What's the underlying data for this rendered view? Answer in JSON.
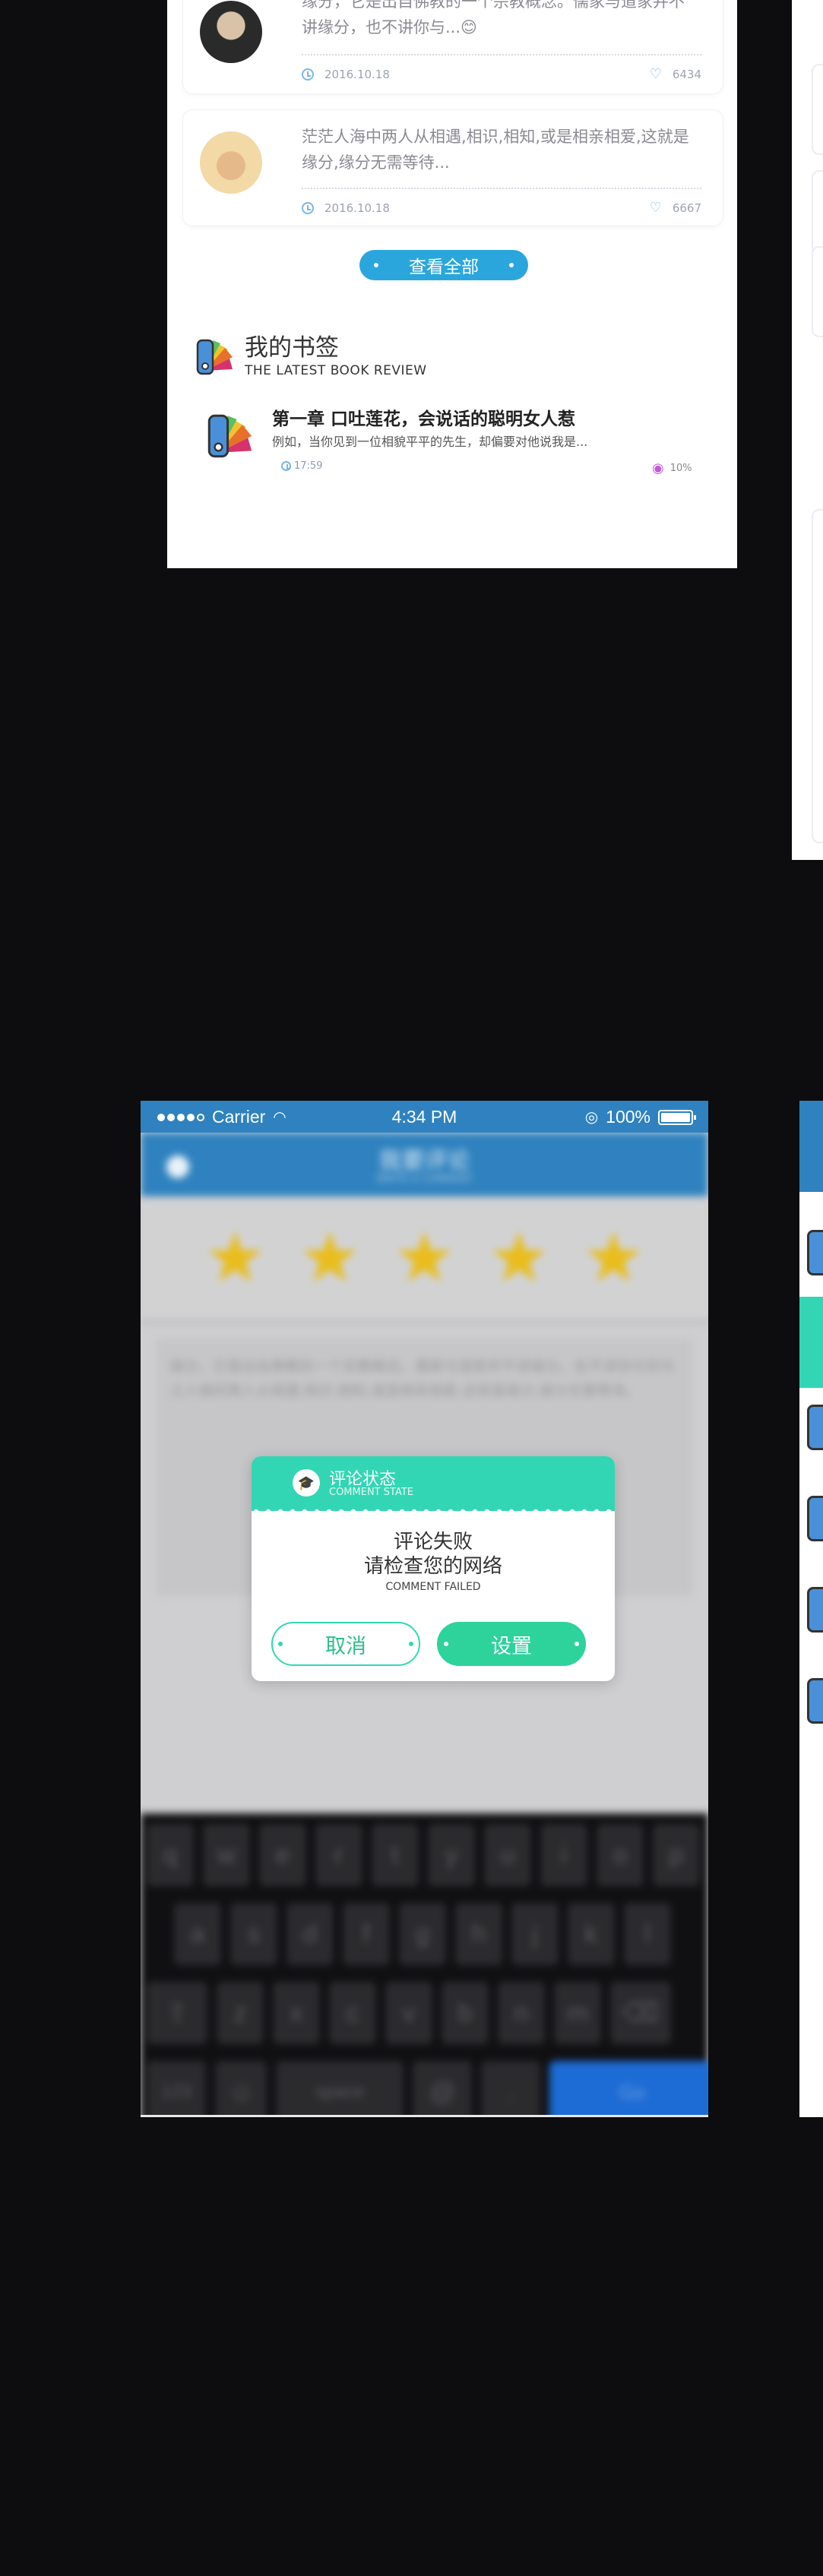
{
  "comments": [
    {
      "text": "缘分，它是出自佛教的一个宗教概念。儒家与道家并不讲缘分，也不讲你与...",
      "emoji": "😊",
      "date": "2016.10.18",
      "likes": "6434"
    },
    {
      "text": "茫茫人海中两人从相遇,相识,相知,或是相亲相爱,这就是缘分,缘分无需等待...",
      "date": "2016.10.18",
      "likes": "6667"
    }
  ],
  "view_all_label": "查看全部",
  "bookmarks": {
    "title": "我的书签",
    "subtitle": "THE LATEST BOOK REVIEW",
    "book_title": "第一章   口吐莲花，会说话的聪明女人惹",
    "excerpt": "例如，当你见到一位相貌平平的先生，却偏要对他说我是...",
    "time": "17:59",
    "progress": "10%"
  },
  "phone": {
    "status": {
      "carrier": "Carrier",
      "time": "4:34 PM",
      "battery": "100%"
    },
    "nav": {
      "title": "我要评论",
      "subtitle": "WRITE A COMMENT"
    },
    "rating_stars": 5,
    "comment_text": "缘分，它是出自佛教的一个宗教概念。儒家与道家并不讲缘分。在不讲你与你与之人做的两人从相遇,相识,相知,或是相亲相爱,这就是缘分,缘分无需等待。",
    "keyboard": {
      "row1": [
        "q",
        "w",
        "e",
        "r",
        "t",
        "y",
        "u",
        "i",
        "o",
        "p"
      ],
      "row2": [
        "a",
        "s",
        "d",
        "f",
        "g",
        "h",
        "j",
        "k",
        "l"
      ],
      "row3": [
        "z",
        "x",
        "c",
        "v",
        "b",
        "n",
        "m"
      ],
      "num": "123",
      "space": "space",
      "at": "@",
      "dot": ".",
      "go": "Go"
    },
    "dialog": {
      "title": "评论状态",
      "subtitle": "COMMENT STATE",
      "message1": "评论失败",
      "message2": "请检查您的网络",
      "message_en": "COMMENT FAILED",
      "cancel": "取消",
      "settings": "设置"
    }
  },
  "colors": {
    "primary_blue": "#2f82bf",
    "button_blue": "#2aa6dd",
    "teal": "#33d6b4",
    "green": "#2dd39a",
    "star": "#e9bd1d"
  }
}
